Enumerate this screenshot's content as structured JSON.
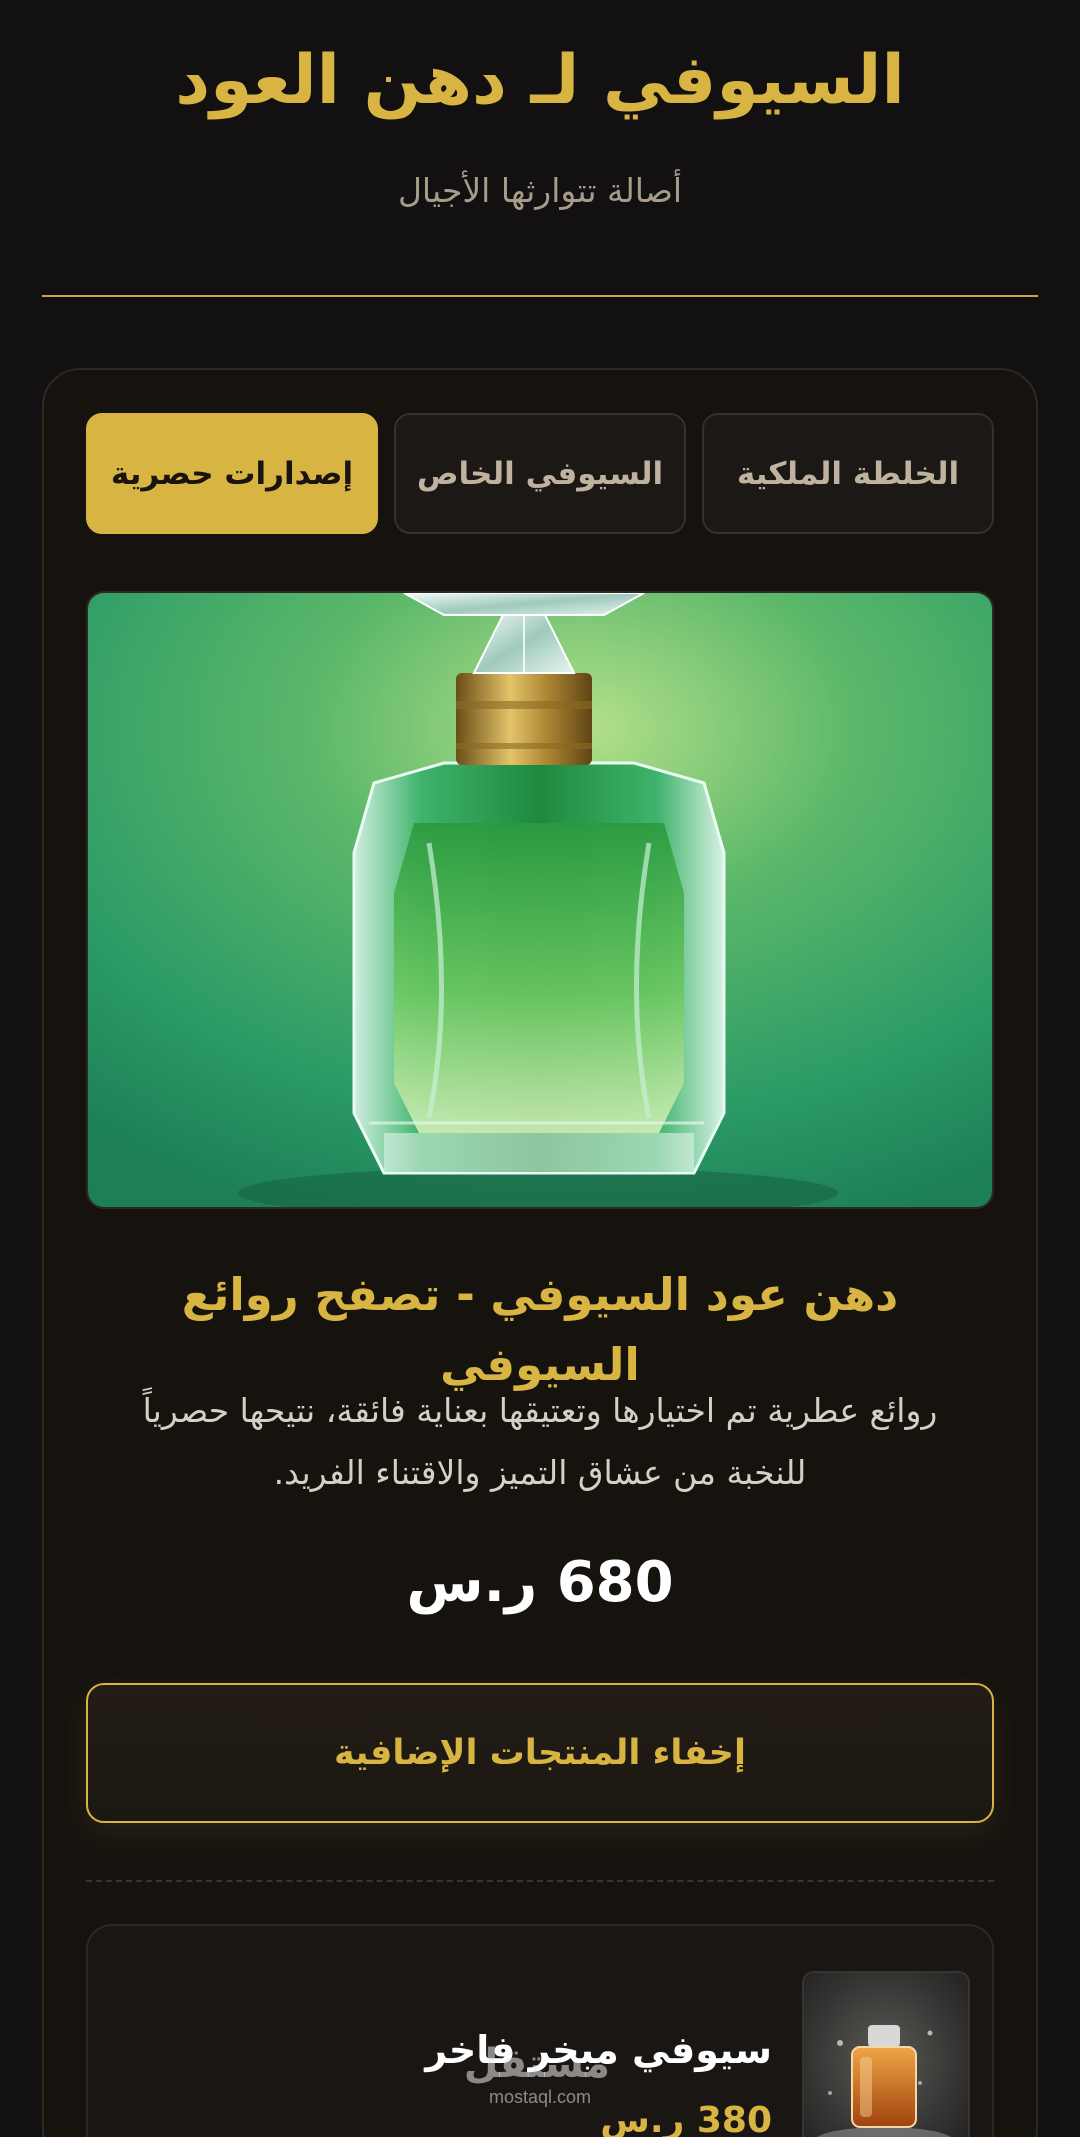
{
  "header": {
    "title": "السيوفي لـ دهن العود",
    "tagline": "أصالة تتوارثها الأجيال"
  },
  "tabs": [
    {
      "label": "الخلطة الملكية",
      "active": false
    },
    {
      "label": "السيوفي الخاص",
      "active": false
    },
    {
      "label": "إصدارات حصرية",
      "active": true
    }
  ],
  "product": {
    "image_icon": "green-perfume-bottle-image",
    "title": "دهن عود السيوفي - تصفح روائع السيوفي",
    "description": "روائع عطرية تم اختيارها وتعتيقها بعناية فائقة، نتيحها حصرياً للنخبة من عشاق التميز والاقتناء الفريد.",
    "price_value": "680",
    "price_currency": "ر.س"
  },
  "toggle_button": {
    "label": "إخفاء المنتجات الإضافية"
  },
  "extra_products": [
    {
      "name": "سيوفي مبخر فاخر",
      "price": "380 ر.س",
      "image_icon": "amber-perfume-bottle-image"
    }
  ],
  "watermark": {
    "logo": "مستقل",
    "url": "mostaql.com"
  },
  "colors": {
    "background": "#121010",
    "accent_gold": "#d8b443",
    "card_background": "#16130f",
    "text_light": "#d6cfc3"
  }
}
